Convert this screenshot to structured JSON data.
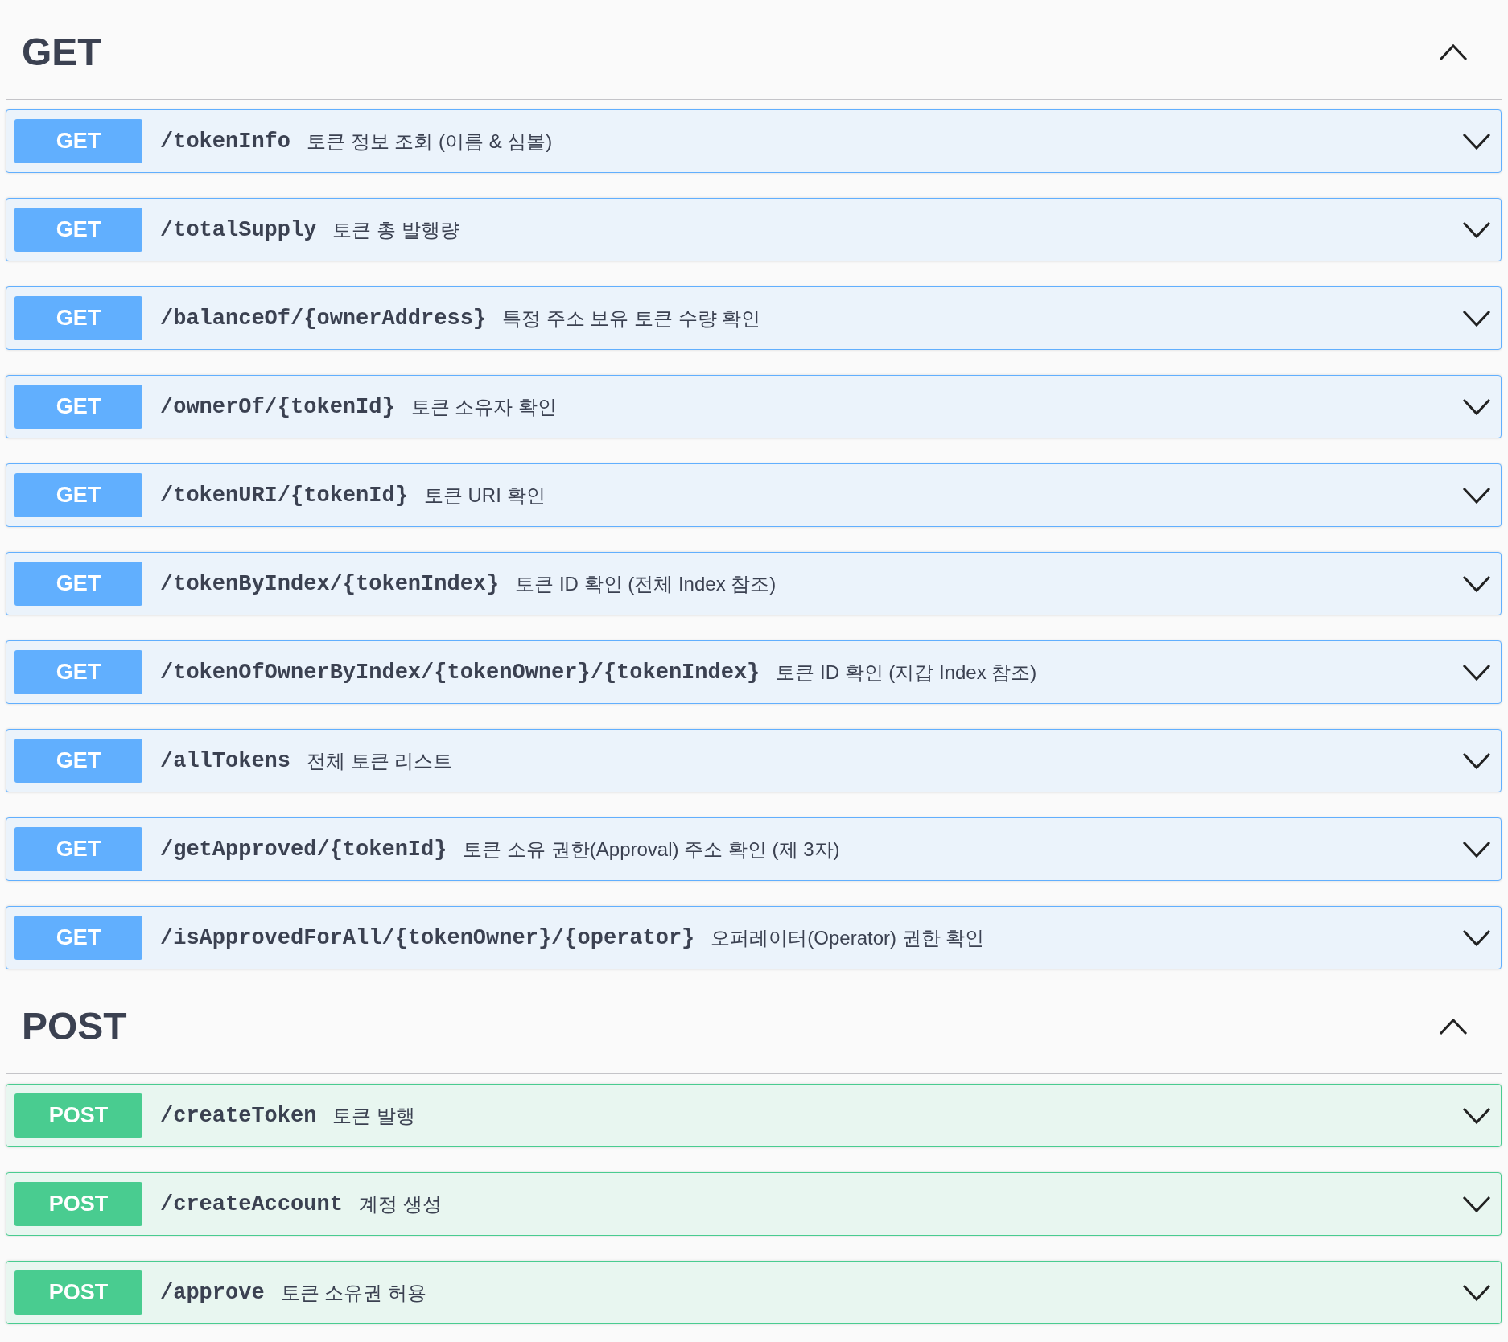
{
  "sections": [
    {
      "title": "GET",
      "kind": "get",
      "expanded": true,
      "operations": [
        {
          "method": "GET",
          "path": "/tokenInfo",
          "summary": "토큰 정보 조회 (이름 & 심볼)",
          "expanded": false
        },
        {
          "method": "GET",
          "path": "/totalSupply",
          "summary": "토큰 총 발행량",
          "expanded": false
        },
        {
          "method": "GET",
          "path": "/balanceOf/{ownerAddress}",
          "summary": "특정 주소 보유 토큰 수량 확인",
          "expanded": false
        },
        {
          "method": "GET",
          "path": "/ownerOf/{tokenId}",
          "summary": "토큰 소유자 확인",
          "expanded": false
        },
        {
          "method": "GET",
          "path": "/tokenURI/{tokenId}",
          "summary": "토큰 URI 확인",
          "expanded": false
        },
        {
          "method": "GET",
          "path": "/tokenByIndex/{tokenIndex}",
          "summary": "토큰 ID 확인 (전체 Index 참조)",
          "expanded": false
        },
        {
          "method": "GET",
          "path": "/tokenOfOwnerByIndex/{tokenOwner}/{tokenIndex}",
          "summary": "토큰 ID 확인 (지갑 Index 참조)",
          "expanded": false
        },
        {
          "method": "GET",
          "path": "/allTokens",
          "summary": "전체 토큰 리스트",
          "expanded": false
        },
        {
          "method": "GET",
          "path": "/getApproved/{tokenId}",
          "summary": "토큰 소유 권한(Approval) 주소 확인 (제 3자)",
          "expanded": false
        },
        {
          "method": "GET",
          "path": "/isApprovedForAll/{tokenOwner}/{operator}",
          "summary": "오퍼레이터(Operator) 권한 확인",
          "expanded": false
        }
      ]
    },
    {
      "title": "POST",
      "kind": "post",
      "expanded": true,
      "operations": [
        {
          "method": "POST",
          "path": "/createToken",
          "summary": "토큰 발행",
          "expanded": false
        },
        {
          "method": "POST",
          "path": "/createAccount",
          "summary": "계정 생성",
          "expanded": false
        },
        {
          "method": "POST",
          "path": "/approve",
          "summary": "토큰 소유권 허용",
          "expanded": false
        }
      ]
    }
  ]
}
